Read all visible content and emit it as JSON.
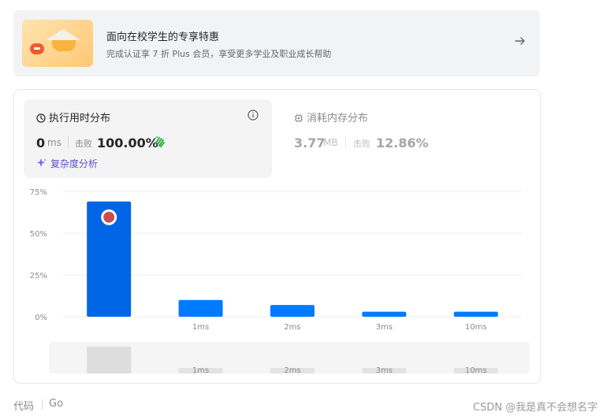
{
  "promo": {
    "title": "面向在校学生的专享特惠",
    "subtitle": "完成认证享 7 折 Plus 会员，享受更多学业及职业成长帮助"
  },
  "runtime": {
    "title": "执行用时分布",
    "value": "0",
    "unit": "ms",
    "beats_label": "击败",
    "percent": "100.00%",
    "complexity_link": "复杂度分析"
  },
  "memory": {
    "title": "消耗内存分布",
    "value": "3.77",
    "unit": "MB",
    "beats_label": "击败",
    "percent": "12.86%"
  },
  "chart_data": {
    "type": "bar",
    "categories": [
      "",
      "1ms",
      "2ms",
      "3ms",
      "10ms"
    ],
    "values": [
      69,
      10,
      7,
      3,
      3
    ],
    "yticks": [
      "0%",
      "25%",
      "50%",
      "75%"
    ],
    "ylim": [
      0,
      75
    ],
    "highlight_index": 0,
    "colors": {
      "highlight": "#0066e6",
      "bar": "#007aff",
      "grid": "#eeeeee"
    },
    "navigator_labels": [
      "1ms",
      "2ms",
      "3ms",
      "10ms"
    ]
  },
  "footer": {
    "code_label": "代码",
    "language": "Go"
  },
  "watermark": "CSDN @我是真不会想名字"
}
